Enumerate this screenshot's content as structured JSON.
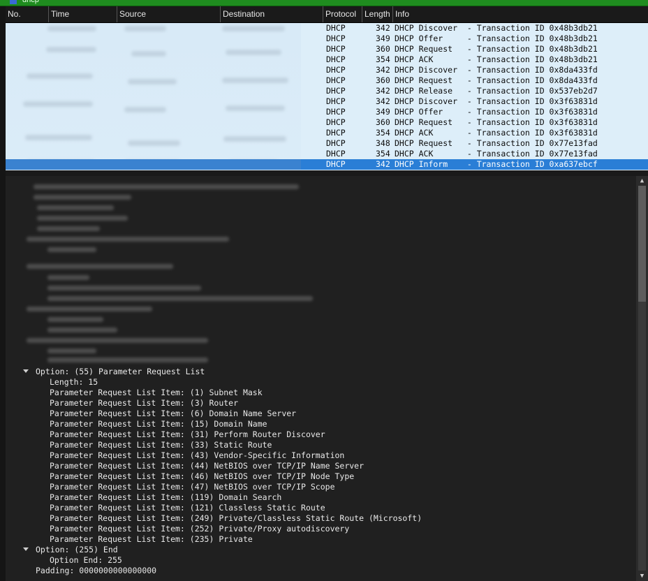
{
  "filter": {
    "text": "dhcp"
  },
  "columns": [
    "No.",
    "Time",
    "Source",
    "Destination",
    "Protocol",
    "Length",
    "Info"
  ],
  "packets": [
    {
      "protocol": "DHCP",
      "length": "342",
      "info": "DHCP Discover  - Transaction ID 0x48b3db21"
    },
    {
      "protocol": "DHCP",
      "length": "349",
      "info": "DHCP Offer     - Transaction ID 0x48b3db21"
    },
    {
      "protocol": "DHCP",
      "length": "360",
      "info": "DHCP Request   - Transaction ID 0x48b3db21"
    },
    {
      "protocol": "DHCP",
      "length": "354",
      "info": "DHCP ACK       - Transaction ID 0x48b3db21"
    },
    {
      "protocol": "DHCP",
      "length": "342",
      "info": "DHCP Discover  - Transaction ID 0x8da433fd"
    },
    {
      "protocol": "DHCP",
      "length": "360",
      "info": "DHCP Request   - Transaction ID 0x8da433fd"
    },
    {
      "protocol": "DHCP",
      "length": "342",
      "info": "DHCP Release   - Transaction ID 0x537eb2d7"
    },
    {
      "protocol": "DHCP",
      "length": "342",
      "info": "DHCP Discover  - Transaction ID 0x3f63831d"
    },
    {
      "protocol": "DHCP",
      "length": "349",
      "info": "DHCP Offer     - Transaction ID 0x3f63831d"
    },
    {
      "protocol": "DHCP",
      "length": "360",
      "info": "DHCP Request   - Transaction ID 0x3f63831d"
    },
    {
      "protocol": "DHCP",
      "length": "354",
      "info": "DHCP ACK       - Transaction ID 0x3f63831d"
    },
    {
      "protocol": "DHCP",
      "length": "348",
      "info": "DHCP Request   - Transaction ID 0x77e13fad"
    },
    {
      "protocol": "DHCP",
      "length": "354",
      "info": "DHCP ACK       - Transaction ID 0x77e13fad"
    },
    {
      "protocol": "DHCP",
      "length": "342",
      "info": "DHCP Inform    - Transaction ID 0xa637ebcf",
      "selected": true
    }
  ],
  "details": {
    "option55_label": "Option: (55) Parameter Request List",
    "length_label": "Length: 15",
    "items": [
      "Parameter Request List Item: (1) Subnet Mask",
      "Parameter Request List Item: (3) Router",
      "Parameter Request List Item: (6) Domain Name Server",
      "Parameter Request List Item: (15) Domain Name",
      "Parameter Request List Item: (31) Perform Router Discover",
      "Parameter Request List Item: (33) Static Route",
      "Parameter Request List Item: (43) Vendor-Specific Information",
      "Parameter Request List Item: (44) NetBIOS over TCP/IP Name Server",
      "Parameter Request List Item: (46) NetBIOS over TCP/IP Node Type",
      "Parameter Request List Item: (47) NetBIOS over TCP/IP Scope",
      "Parameter Request List Item: (119) Domain Search",
      "Parameter Request List Item: (121) Classless Static Route",
      "Parameter Request List Item: (249) Private/Classless Static Route (Microsoft)",
      "Parameter Request List Item: (252) Private/Proxy autodiscovery",
      "Parameter Request List Item: (235) Private"
    ],
    "option255_label": "Option: (255) End",
    "option_end_label": "Option End: 255",
    "padding_label": "Padding: 0000000000000000"
  },
  "colors": {
    "selected": "#2a7ed6",
    "list_bg": "#ddeef9",
    "details_bg": "#202020"
  }
}
